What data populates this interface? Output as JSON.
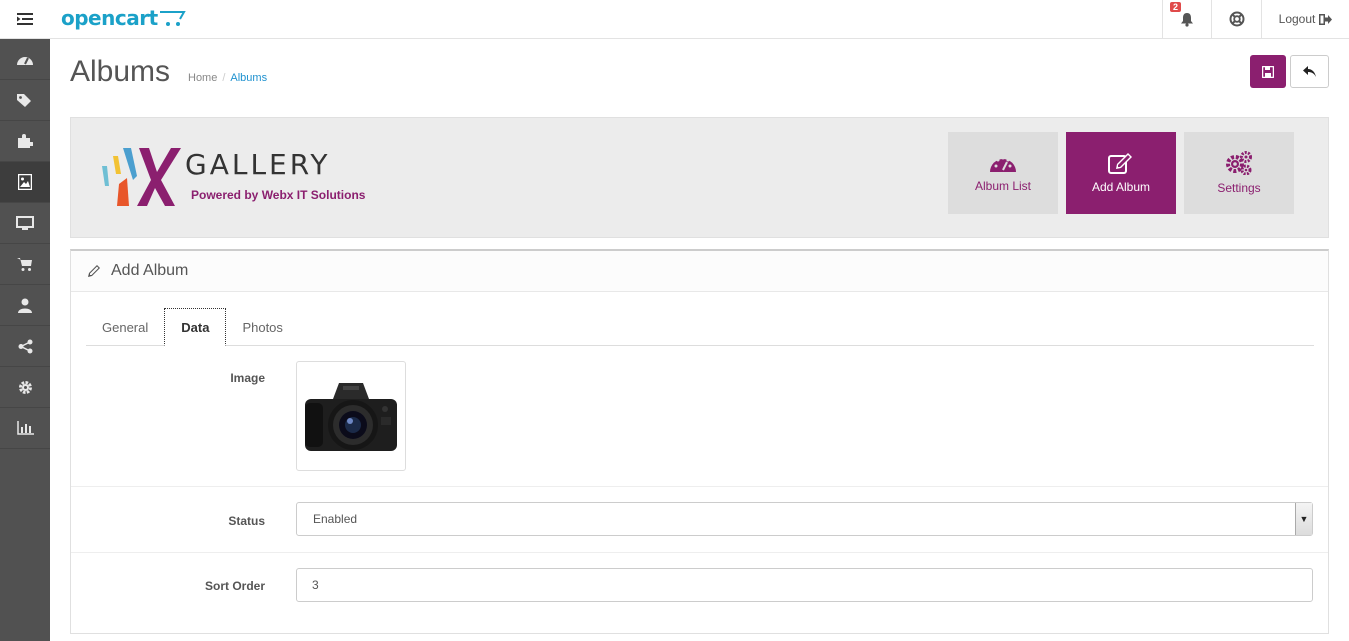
{
  "header": {
    "logo_text": "opencart",
    "notification_count": "2",
    "logout_label": "Logout"
  },
  "sidebar": {
    "items": [
      {
        "icon": "dashboard-icon"
      },
      {
        "icon": "tags-icon"
      },
      {
        "icon": "puzzle-icon"
      },
      {
        "icon": "image-icon",
        "active": true
      },
      {
        "icon": "desktop-icon"
      },
      {
        "icon": "cart-icon"
      },
      {
        "icon": "user-icon"
      },
      {
        "icon": "share-icon"
      },
      {
        "icon": "cog-icon"
      },
      {
        "icon": "bar-chart-icon"
      }
    ]
  },
  "page": {
    "title": "Albums",
    "breadcrumb": [
      "Home",
      "Albums"
    ]
  },
  "banner": {
    "brand": "GALLERY",
    "brand_mark": "NX",
    "subtitle": "Powered by Webx IT Solutions",
    "tiles": [
      {
        "label": "Album List",
        "icon": "dashboard-icon"
      },
      {
        "label": "Add Album",
        "icon": "edit-icon",
        "active": true
      },
      {
        "label": "Settings",
        "icon": "cogs-icon"
      }
    ]
  },
  "panel": {
    "heading": "Add Album",
    "tabs": [
      {
        "label": "General"
      },
      {
        "label": "Data",
        "active": true
      },
      {
        "label": "Photos"
      }
    ],
    "fields": {
      "image_label": "Image",
      "status_label": "Status",
      "status_value": "Enabled",
      "sort_order_label": "Sort Order",
      "sort_order_value": "3"
    }
  },
  "colors": {
    "accent": "#8b1f6f",
    "sidebar": "#515151",
    "brand_blue": "#1ba1c8"
  }
}
